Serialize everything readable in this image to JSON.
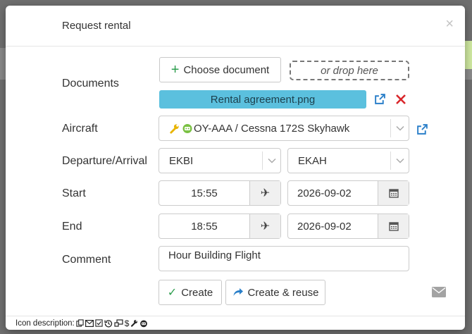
{
  "modal": {
    "title": "Request rental",
    "close_glyph": "×"
  },
  "documents": {
    "label": "Documents",
    "choose_button": "Choose document",
    "drop_text": "or drop here",
    "file_name": "Rental agreement.png"
  },
  "aircraft": {
    "label": "Aircraft",
    "value": "OY-AAA / Cessna 172S Skyhawk",
    "icons": [
      "wrench-icon",
      "robot-icon"
    ]
  },
  "route": {
    "label": "Departure/Arrival",
    "departure": "EKBI",
    "arrival": "EKAH"
  },
  "start": {
    "label": "Start",
    "time": "15:55",
    "date": "2026-09-02"
  },
  "end": {
    "label": "End",
    "time": "18:55",
    "date": "2026-09-02"
  },
  "comment": {
    "label": "Comment",
    "value": "Hour Building Flight"
  },
  "actions": {
    "create": "Create",
    "create_reuse": "Create & reuse"
  },
  "footer": {
    "label": "Icon description:",
    "icons": [
      "copy-icon",
      "envelope-icon",
      "check-square-icon",
      "history-icon",
      "transfer-icon",
      "dollar-icon",
      "wrench-icon",
      "robot-icon"
    ]
  },
  "colors": {
    "chip": "#5bc0de",
    "plus": "#2e9e4f",
    "check": "#2e9e4f",
    "link": "#2a7fc9",
    "remove": "#d9262b"
  }
}
